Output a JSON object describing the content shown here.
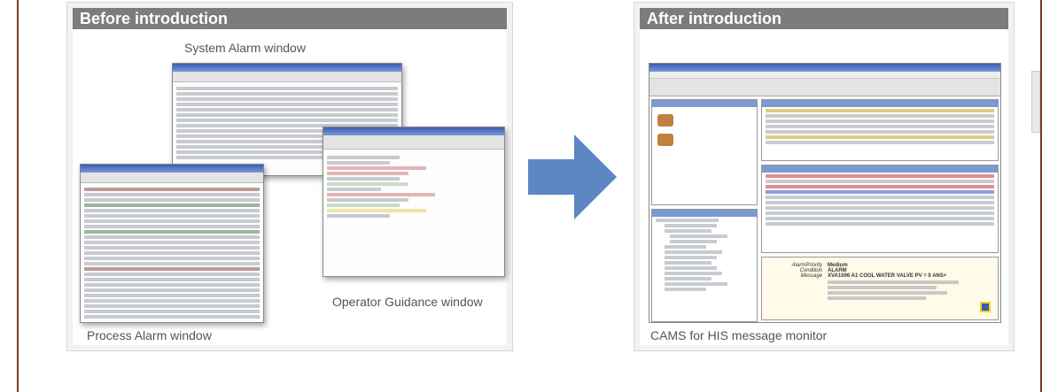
{
  "before": {
    "header": "Before introduction",
    "captions": {
      "system_alarm": "System Alarm window",
      "operator_guidance": "Operator Guidance window",
      "process_alarm": "Process Alarm window"
    }
  },
  "after": {
    "header": "After introduction",
    "caption": "CAMS for HIS message monitor",
    "detail_fields": {
      "alarm_priority": "Medium",
      "condition": "ALARM",
      "message": "XVA1006 A1 COOL WATER VALVE PV = 0 ANS+"
    }
  },
  "colors": {
    "header_bg": "#7c7c7c",
    "arrow": "#5b87c2",
    "rule": "#7a3a2a"
  }
}
